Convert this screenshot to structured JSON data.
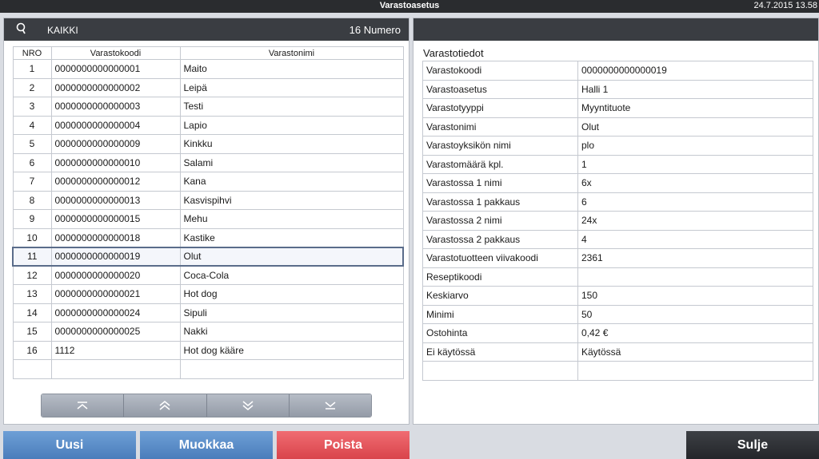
{
  "app": {
    "title": "Varastoasetus",
    "datetime": "24.7.2015 13.58"
  },
  "list_header": {
    "filter": "KAIKKI",
    "count": "16",
    "sort": "Numero"
  },
  "table": {
    "columns": [
      "NRO",
      "Varastokoodi",
      "Varastonimi"
    ],
    "rows": [
      {
        "nro": "1",
        "code": "0000000000000001",
        "name": "Maito"
      },
      {
        "nro": "2",
        "code": "0000000000000002",
        "name": "Leipä"
      },
      {
        "nro": "3",
        "code": "0000000000000003",
        "name": "Testi"
      },
      {
        "nro": "4",
        "code": "0000000000000004",
        "name": "Lapio"
      },
      {
        "nro": "5",
        "code": "0000000000000009",
        "name": "Kinkku"
      },
      {
        "nro": "6",
        "code": "0000000000000010",
        "name": "Salami"
      },
      {
        "nro": "7",
        "code": "0000000000000012",
        "name": "Kana"
      },
      {
        "nro": "8",
        "code": "0000000000000013",
        "name": "Kasvispihvi"
      },
      {
        "nro": "9",
        "code": "0000000000000015",
        "name": "Mehu"
      },
      {
        "nro": "10",
        "code": "0000000000000018",
        "name": "Kastike"
      },
      {
        "nro": "11",
        "code": "0000000000000019",
        "name": "Olut"
      },
      {
        "nro": "12",
        "code": "0000000000000020",
        "name": "Coca-Cola"
      },
      {
        "nro": "13",
        "code": "0000000000000021",
        "name": "Hot dog"
      },
      {
        "nro": "14",
        "code": "0000000000000024",
        "name": "Sipuli"
      },
      {
        "nro": "15",
        "code": "0000000000000025",
        "name": "Nakki"
      },
      {
        "nro": "16",
        "code": "1112",
        "name": "Hot dog kääre"
      }
    ],
    "selected_index": 10
  },
  "details": {
    "title": "Varastotiedot",
    "fields": [
      {
        "label": "Varastokoodi",
        "value": "0000000000000019"
      },
      {
        "label": "Varastoasetus",
        "value": "Halli 1"
      },
      {
        "label": "Varastotyyppi",
        "value": "Myyntituote"
      },
      {
        "label": "Varastonimi",
        "value": "Olut"
      },
      {
        "label": "Varastoyksikön nimi",
        "value": "plo"
      },
      {
        "label": "Varastomäärä kpl.",
        "value": "1"
      },
      {
        "label": "Varastossa 1 nimi",
        "value": "6x"
      },
      {
        "label": "Varastossa 1 pakkaus",
        "value": "6"
      },
      {
        "label": "Varastossa 2 nimi",
        "value": "24x"
      },
      {
        "label": "Varastossa 2 pakkaus",
        "value": "4"
      },
      {
        "label": "Varastotuotteen viivakoodi",
        "value": "2361"
      },
      {
        "label": "Reseptikoodi",
        "value": ""
      },
      {
        "label": "Keskiarvo",
        "value": "150"
      },
      {
        "label": "Minimi",
        "value": "50"
      },
      {
        "label": "Ostohinta",
        "value": "0,42 €"
      },
      {
        "label": "Ei käytössä",
        "value": "Käytössä"
      }
    ]
  },
  "pager": {
    "icons": [
      "first-page-icon",
      "page-up-icon",
      "page-down-icon",
      "last-page-icon"
    ]
  },
  "buttons": {
    "new": "Uusi",
    "edit": "Muokkaa",
    "delete": "Poista",
    "close": "Sulje"
  },
  "colors": {
    "topbar": "#2a2c2f",
    "header": "#3a3d42",
    "blue_button": "#5a8ac6",
    "red_button": "#e55a60",
    "dark_button": "#303236",
    "selection_border": "#5a6c8a"
  }
}
